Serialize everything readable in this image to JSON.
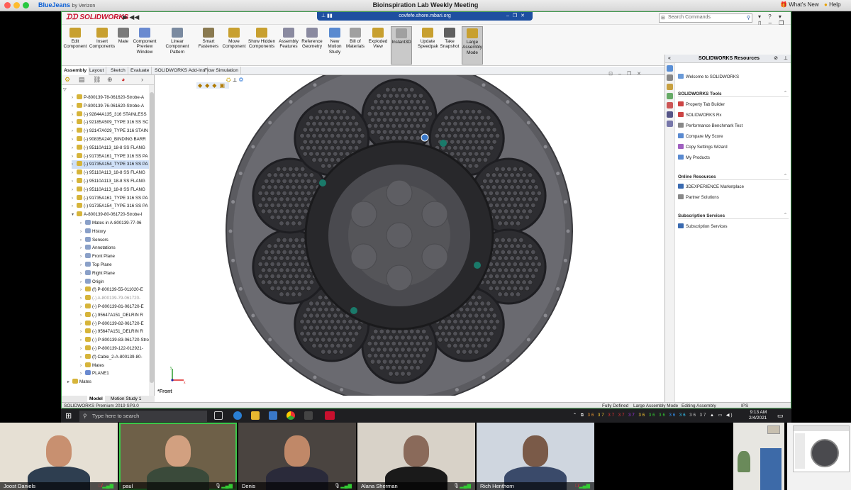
{
  "mac_bar": {
    "app_name": "BlueJeans",
    "app_sub": "by Verizon",
    "title": "Bioinspiration Lab Weekly Meeting",
    "whats_new": "What's New",
    "help": "Help"
  },
  "remote": {
    "host": "covfefe.shore.mbari.org"
  },
  "solidworks": {
    "logo": "SOLIDWORKS",
    "search_placeholder": "Search Commands",
    "ribbon": [
      "Edit Component",
      "Insert Components",
      "Mate",
      "Component Preview Window",
      "Linear Component Pattern",
      "Smart Fasteners",
      "Move Component",
      "Show Hidden Components",
      "Assembly Features",
      "Reference Geometry",
      "New Motion Study",
      "Bill of Materials",
      "Exploded View",
      "Instant3D",
      "Update Speedpak",
      "Take Snapshot",
      "Large Assembly Mode"
    ],
    "tabs": [
      "Assembly",
      "Layout",
      "Sketch",
      "Evaluate",
      "SOLIDWORKS Add-Ins",
      "Flow Simulation"
    ],
    "tree": [
      "P-800139-78-061620-Strobe-A",
      "P-800139-76-061620-Strobe-A",
      "(-) 92844A135_316 STAINLESS",
      "(-) 92185A509_TYPE 316 SS SC",
      "(-) 92147A029_TYPE 316 STAIN",
      "(-) 90835A240_BINDING BARR",
      "(-) 95110A113_18-8 SS FLANG",
      "(-) 91735A161_TYPE 316 SS PA",
      "(-) 91735A154_TYPE 316 SS PA",
      "(-) 95110A113_18-8 SS FLANG",
      "(-) 95110A113_18-8 SS FLANG",
      "(-) 95110A113_18-8 SS FLANG",
      "(-) 91735A161_TYPE 316 SS PA",
      "(-) 91735A154_TYPE 316 SS PA",
      "A-800139-80-061720-Strobe-I",
      "Mates in A-800139-77-06",
      "History",
      "Sensors",
      "Annotations",
      "Front Plane",
      "Top Plane",
      "Right Plane",
      "Origin",
      "(f) P-800139-55-011020-E",
      "(-) A-800139-79-061720-",
      "(-) P-800139-81-061720-E",
      "(-) 95647A151_DELRIN R",
      "(-) P-800139-82-061720-E",
      "(-) 95647A151_DELRIN R",
      "(-) P-800139-83-061720-Stro",
      "(-) P-800139-122-012921-",
      "(f) Cable_2-A-800139-80-",
      "Mates",
      "PLANE1",
      "Mates"
    ],
    "bottom_tabs": [
      "Model",
      "Motion Study 1"
    ],
    "view_name": "*Front",
    "status": {
      "version": "SOLIDWORKS Premium 2019 SP3.0",
      "defined": "Fully Defined",
      "mode": "Large Assembly Mode",
      "editing": "Editing Assembly",
      "units": "IPS"
    },
    "resources": {
      "title": "SOLIDWORKS Resources",
      "welcome": "Welcome to SOLIDWORKS",
      "tools_header": "SOLIDWORKS Tools",
      "tools": [
        "Property Tab Builder",
        "SOLIDWORKS Rx",
        "Performance Benchmark Test",
        "Compare My Score",
        "Copy Settings Wizard",
        "My Products"
      ],
      "online_header": "Online Resources",
      "online": [
        "3DEXPERIENCE Marketplace",
        "Partner Solutions"
      ],
      "subscription_header": "Subscription Services",
      "subscription": [
        "Subscription Services"
      ]
    }
  },
  "taskbar": {
    "search_placeholder": "Type here to search",
    "time": "9:13 AM",
    "date": "2/4/2021"
  },
  "participants": [
    {
      "name": "Joost Daniels",
      "muted": true
    },
    {
      "name": "paul",
      "muted": false
    },
    {
      "name": "Denis",
      "muted": false
    },
    {
      "name": "Alana Sherman",
      "muted": false
    },
    {
      "name": "Rich Henthorn",
      "muted": true
    }
  ]
}
